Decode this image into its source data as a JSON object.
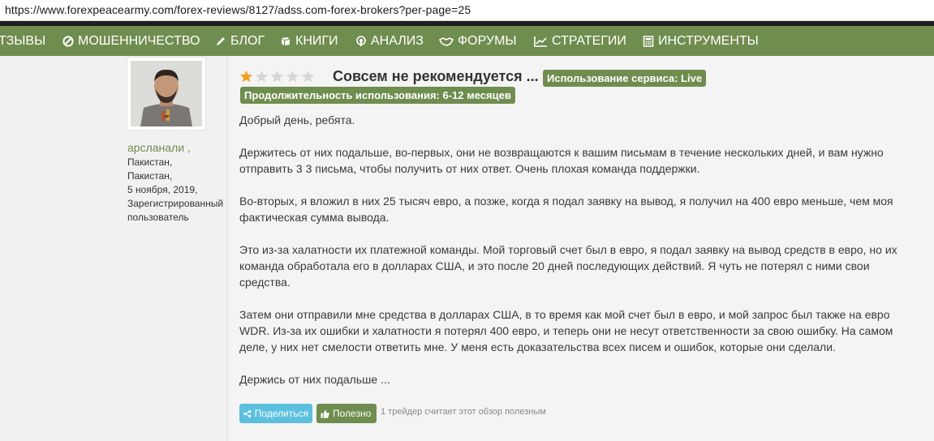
{
  "browser": {
    "url": "https://www.forexpeacearmy.com/forex-reviews/8127/adss.com-forex-brokers?per-page=25"
  },
  "nav": {
    "items": [
      {
        "label": "ТЗЫВЫ",
        "icon": ""
      },
      {
        "label": "МОШЕННИЧЕСТВО",
        "icon": "ban-icon"
      },
      {
        "label": "БЛОГ",
        "icon": "pencil-icon"
      },
      {
        "label": "КНИГИ",
        "icon": "book-icon"
      },
      {
        "label": "АНАЛИЗ",
        "icon": "podcast-icon"
      },
      {
        "label": "ФОРУМЫ",
        "icon": "handshake-icon"
      },
      {
        "label": "СТРАТЕГИИ",
        "icon": "line-chart-icon"
      },
      {
        "label": "ИНСТРУМЕНТЫ",
        "icon": "calculator-icon"
      }
    ]
  },
  "user": {
    "name": "арсланали",
    "comma": " ,",
    "meta": [
      "Пакистан,",
      "Пакистан,",
      "5 ноября, 2019,",
      "Зарегистрированный",
      "пользователь"
    ]
  },
  "review": {
    "rating": 1,
    "max_rating": 5,
    "title": "Совсем не рекомендуется ...",
    "badge_service": "Использование сервиса: Live",
    "badge_duration": "Продолжительность использования: 6-12 месяцев",
    "paragraphs": [
      "Добрый день, ребята.",
      "Держитесь от них подальше, во-первых, они не возвращаются к вашим письмам в течение нескольких дней, и вам нужно отправить 3 3 письма, чтобы получить от них ответ. Очень плохая команда поддержки.",
      "Во-вторых, я вложил в них 25 тысяч евро, а позже, когда я подал заявку на вывод, я получил на 400 евро меньше, чем моя фактическая сумма вывода.",
      "Это из-за халатности их платежной команды. Мой торговый счет был в евро, я подал заявку на вывод средств в евро, но их команда обработала его в долларах США, и это после 20 дней последующих действий. Я чуть не потерял с ними свои средства.",
      "Затем они отправили мне средства в долларах США, в то время как мой счет был в евро, и мой запрос был также на евро WDR. Из-за их ошибки и халатности я потерял 400 евро, и теперь они не несут ответственности за свою ошибку. На самом деле, у них нет смелости ответить мне. У меня есть доказательства всех писем и ошибок, которые они сделали.",
      "Держись от них подальше ..."
    ],
    "share_label": "Поделиться",
    "useful_label": "Полезно",
    "useful_text": "1 трейдер считает этот обзор полезным"
  },
  "colors": {
    "brand_green": "#6f8d4f",
    "share_blue": "#5bc0de",
    "star_active": "#f0a11d",
    "star_inactive": "#d6d6d6"
  }
}
